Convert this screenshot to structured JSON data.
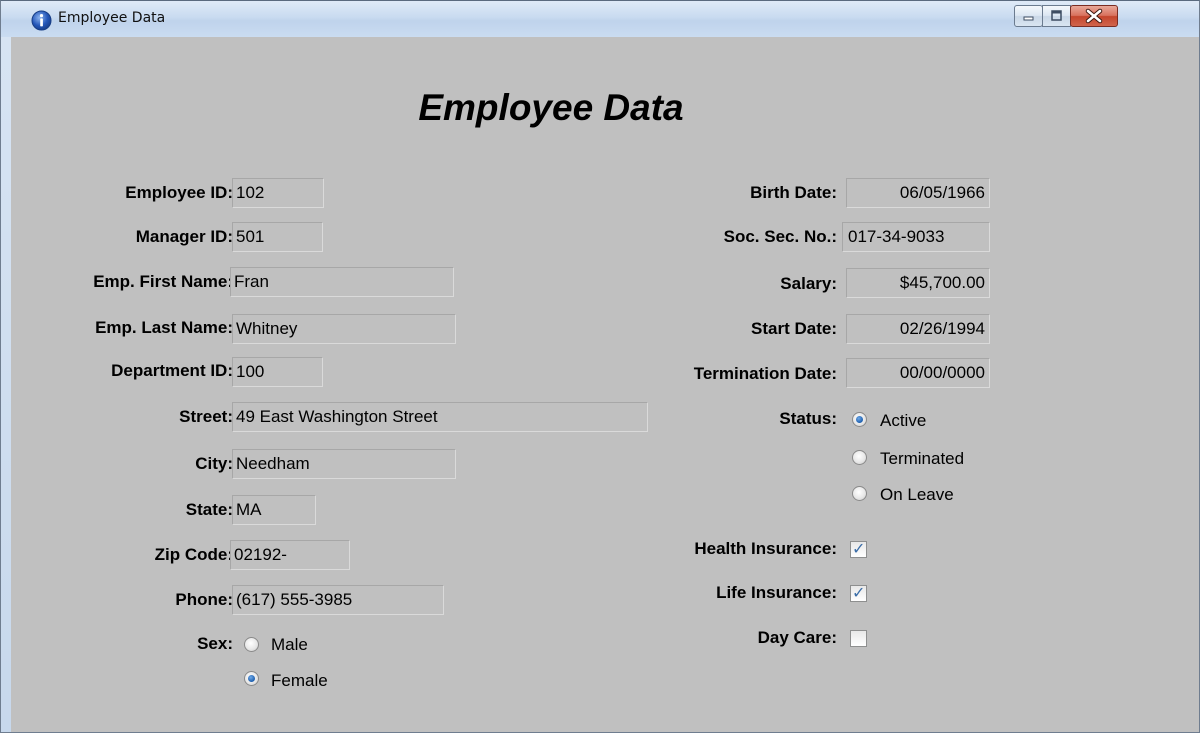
{
  "window": {
    "title": "Employee Data",
    "heading": "Employee Data"
  },
  "left": {
    "employee_id": {
      "label": "Employee ID:",
      "value": "102"
    },
    "manager_id": {
      "label": "Manager ID:",
      "value": "501"
    },
    "first_name": {
      "label": "Emp. First Name:",
      "value": "Fran"
    },
    "last_name": {
      "label": "Emp. Last Name:",
      "value": "Whitney"
    },
    "department_id": {
      "label": "Department ID:",
      "value": "100"
    },
    "street": {
      "label": "Street:",
      "value": "49 East Washington Street"
    },
    "city": {
      "label": "City:",
      "value": "Needham"
    },
    "state": {
      "label": "State:",
      "value": "MA"
    },
    "zip": {
      "label": "Zip Code:",
      "value": "02192-"
    },
    "phone": {
      "label": "Phone:",
      "value": "(617) 555-3985"
    },
    "sex": {
      "label": "Sex:",
      "options": [
        "Male",
        "Female"
      ],
      "selected": "Female"
    }
  },
  "right": {
    "birth_date": {
      "label": "Birth Date:",
      "value": "06/05/1966"
    },
    "ssn": {
      "label": "Soc. Sec. No.:",
      "value": "017-34-9033"
    },
    "salary": {
      "label": "Salary:",
      "value": "$45,700.00"
    },
    "start_date": {
      "label": "Start Date:",
      "value": "02/26/1994"
    },
    "termination_date": {
      "label": "Termination Date:",
      "value": "00/00/0000"
    },
    "status": {
      "label": "Status:",
      "options": [
        "Active",
        "Terminated",
        "On Leave"
      ],
      "selected": "Active"
    },
    "health_insurance": {
      "label": "Health Insurance:",
      "checked": true
    },
    "life_insurance": {
      "label": "Life Insurance:",
      "checked": true
    },
    "day_care": {
      "label": "Day Care:",
      "checked": false
    }
  },
  "colors": {
    "background": "#c0c0c0",
    "radio_selected": "#1e5fae",
    "checkmark": "#3c6ea8",
    "close_button": "#c4452c"
  },
  "icons": {
    "app": "info-icon",
    "minimize": "minimize-icon",
    "maximize": "restore-icon",
    "close": "close-icon"
  }
}
